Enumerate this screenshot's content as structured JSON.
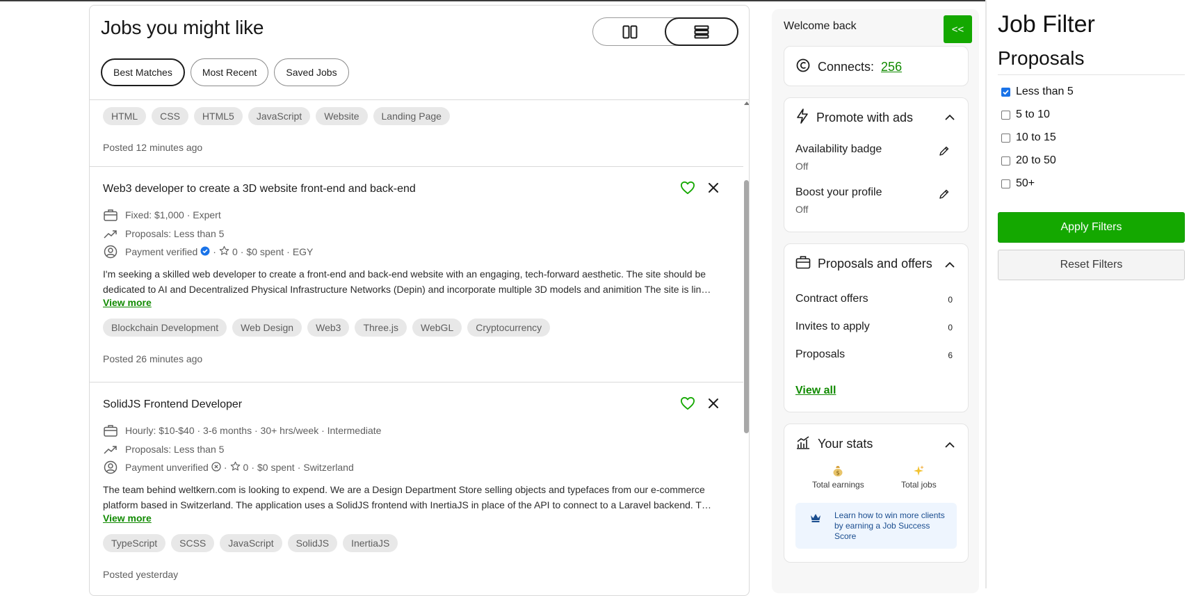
{
  "main": {
    "title": "Jobs you might like",
    "tabs": [
      {
        "label": "Best Matches",
        "active": true
      },
      {
        "label": "Most Recent",
        "active": false
      },
      {
        "label": "Saved Jobs",
        "active": false
      }
    ],
    "partial_job": {
      "tags": [
        "HTML",
        "CSS",
        "HTML5",
        "JavaScript",
        "Website",
        "Landing Page"
      ],
      "posted": "Posted 12 minutes ago"
    },
    "jobs": [
      {
        "title": "Web3 developer to create a 3D website front-end and back-end",
        "budget": "Fixed: $1,000 · Expert",
        "proposals": "Proposals: Less than 5",
        "payment": "Payment verified",
        "payment_verified": true,
        "rating": "0",
        "spent": "$0 spent",
        "location": "EGY",
        "desc_line1": "I'm seeking a skilled web developer to create a front-end and back-end website with an engaging, tech-forward aesthetic. The site should be",
        "desc_line2": "dedicated to AI and Decentralized Physical Infrastructure Networks (Depin) and incorporate multiple 3D models and animition The site is linked...",
        "view_more": "View more",
        "tags": [
          "Blockchain Development",
          "Web Design",
          "Web3",
          "Three.js",
          "WebGL",
          "Cryptocurrency"
        ],
        "posted": "Posted 26 minutes ago"
      },
      {
        "title": "SolidJS Frontend Developer",
        "budget": "Hourly: $10-$40 · 3-6 months · 30+ hrs/week · Intermediate",
        "proposals": "Proposals: Less than 5",
        "payment": "Payment unverified",
        "payment_verified": false,
        "rating": "0",
        "spent": "$0 spent",
        "location": "Switzerland",
        "desc_line1": "The team behind weltkern.com is looking to expend. We are a Design Department Store selling objects and typefaces from our e-commerce",
        "desc_line2": "platform based in Switzerland. The application uses a SolidJS frontend with InertiaJS in place of the API to connect to a Laravel backend. The...",
        "view_more": "View more",
        "tags": [
          "TypeScript",
          "SCSS",
          "JavaScript",
          "SolidJS",
          "InertiaJS"
        ],
        "posted": "Posted yesterday"
      }
    ]
  },
  "sidebar": {
    "welcome": "Welcome back",
    "collapse_label": "<<",
    "connects_label": "Connects:",
    "connects_value": "256",
    "promote": {
      "title": "Promote with ads",
      "items": [
        {
          "label": "Availability badge",
          "status": "Off"
        },
        {
          "label": "Boost your profile",
          "status": "Off"
        }
      ]
    },
    "proposals": {
      "title": "Proposals and offers",
      "items": [
        {
          "label": "Contract offers",
          "count": "0"
        },
        {
          "label": "Invites to apply",
          "count": "0"
        },
        {
          "label": "Proposals",
          "count": "6"
        }
      ],
      "view_all": "View all"
    },
    "stats": {
      "title": "Your stats",
      "total_earnings": "Total earnings",
      "total_jobs": "Total jobs",
      "learn": "Learn how to win more clients by earning a Job Success Score"
    }
  },
  "filter": {
    "title": "Job Filter",
    "section": "Proposals",
    "options": [
      {
        "label": "Less than 5",
        "checked": true
      },
      {
        "label": "5 to 10",
        "checked": false
      },
      {
        "label": "10 to 15",
        "checked": false
      },
      {
        "label": "20 to 50",
        "checked": false
      },
      {
        "label": "50+",
        "checked": false
      }
    ],
    "apply": "Apply Filters",
    "reset": "Reset Filters"
  },
  "colors": {
    "brand_green": "#14a800",
    "link_green": "#108a00",
    "verified_blue": "#1a73e8"
  }
}
